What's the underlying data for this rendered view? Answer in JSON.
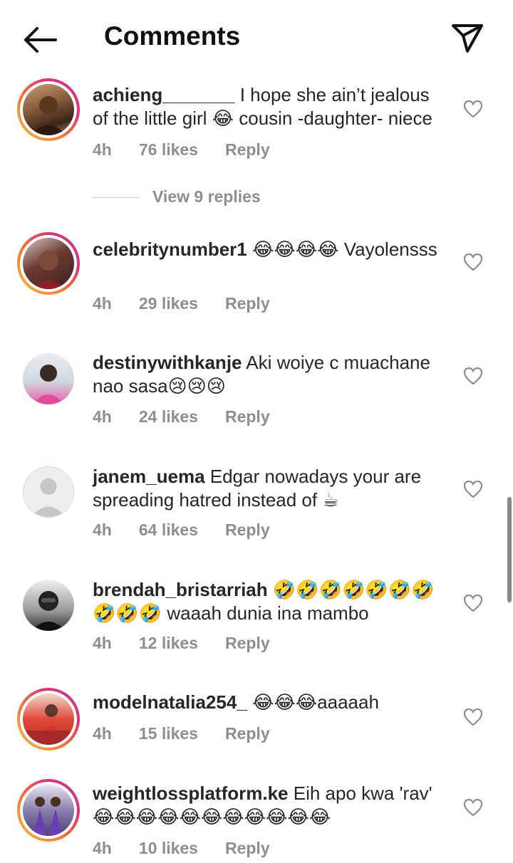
{
  "header": {
    "title": "Comments"
  },
  "comments": [
    {
      "user": "achieng_______",
      "text": " I hope she ain’t jealous of the little girl 😂 cousin -daughter- niece",
      "time": "4h",
      "likes": "76 likes",
      "reply": "Reply",
      "view_replies": "View 9 replies"
    },
    {
      "user": "celebritynumber1",
      "text": " 😂😂😂😂 Vayolensss",
      "time": "4h",
      "likes": "29 likes",
      "reply": "Reply"
    },
    {
      "user": "destinywithkanje",
      "text": " Aki woiye c muachane nao sasa😢😢😢",
      "time": "4h",
      "likes": "24 likes",
      "reply": "Reply"
    },
    {
      "user": "janem_uema",
      "text": " Edgar nowadays your are spreading hatred instead of ☕",
      "time": "4h",
      "likes": "64 likes",
      "reply": "Reply"
    },
    {
      "user": "brendah_bristarriah",
      "text": " 🤣🤣🤣🤣🤣🤣🤣 🤣🤣🤣 waaah dunia ina mambo",
      "time": "4h",
      "likes": "12 likes",
      "reply": "Reply"
    },
    {
      "user": "modelnatalia254_",
      "text": " 😂😂😂aaaaah",
      "time": "4h",
      "likes": "15 likes",
      "reply": "Reply"
    },
    {
      "user": "weightlossplatform.ke",
      "text": " Eih apo kwa 'rav' 😂😂😂😂😂😂😂😂😂😂😂",
      "time": "4h",
      "likes": "10 likes",
      "reply": "Reply"
    }
  ],
  "icons": {
    "back": "arrow-left-icon",
    "send": "send-paper-plane-icon",
    "like": "heart-outline-icon"
  },
  "colors": {
    "text": "#262626",
    "meta": "#8e8e8e",
    "story_ring_start": "#f9c04b",
    "story_ring_end": "#b83a9e"
  }
}
